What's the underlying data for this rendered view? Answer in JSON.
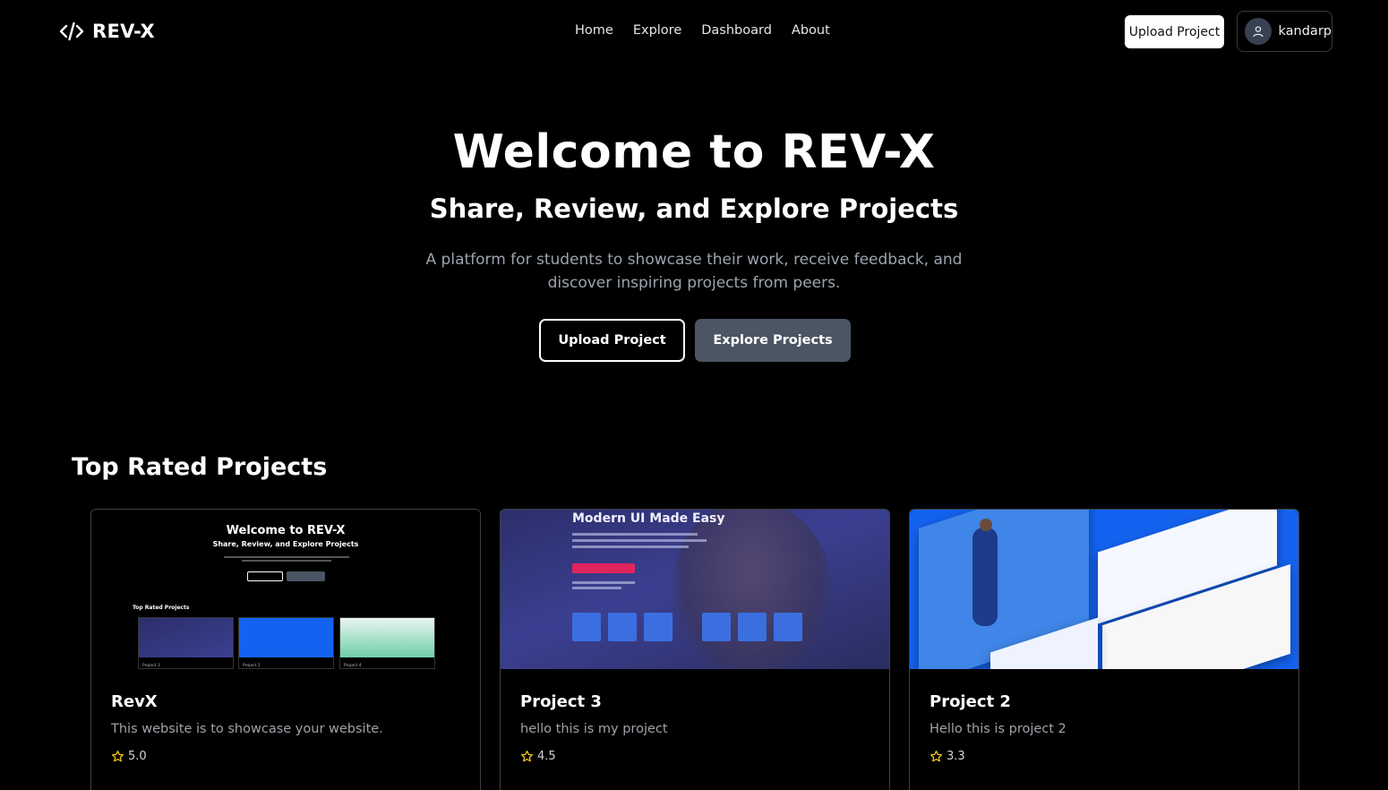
{
  "nav": {
    "logo_text": "REV-X",
    "links": [
      "Home",
      "Explore",
      "Dashboard",
      "About"
    ],
    "upload_label": "Upload Project",
    "username": "kandarp"
  },
  "hero": {
    "title": "Welcome to REV-X",
    "subtitle": "Share, Review, and Explore Projects",
    "description": "A platform for students to showcase their work, receive feedback, and discover inspiring projects from peers.",
    "upload_label": "Upload Project",
    "explore_label": "Explore Projects"
  },
  "section": {
    "title": "Top Rated Projects"
  },
  "projects": [
    {
      "title": "RevX",
      "description": "This website is to showcase your website.",
      "rating": "5.0",
      "thumb": {
        "title": "Welcome to REV-X",
        "subtitle": "Share, Review, and Explore Projects",
        "section": "Top Rated Projects",
        "captions": [
          "Project 3",
          "Project 2",
          "Project 4"
        ]
      }
    },
    {
      "title": "Project 3",
      "description": "hello this is my project",
      "rating": "4.5",
      "thumb": {
        "headline": "Modern UI Made Easy"
      }
    },
    {
      "title": "Project 2",
      "description": "Hello this is project 2",
      "rating": "3.3",
      "thumb": {}
    }
  ],
  "colors": {
    "background": "#000000",
    "secondary_button": "#4b5563",
    "muted_text": "#9ca3af",
    "star": "#facc15"
  },
  "icons": {
    "logo": "code-brackets-icon",
    "avatar": "user-icon",
    "rating": "star-icon"
  }
}
